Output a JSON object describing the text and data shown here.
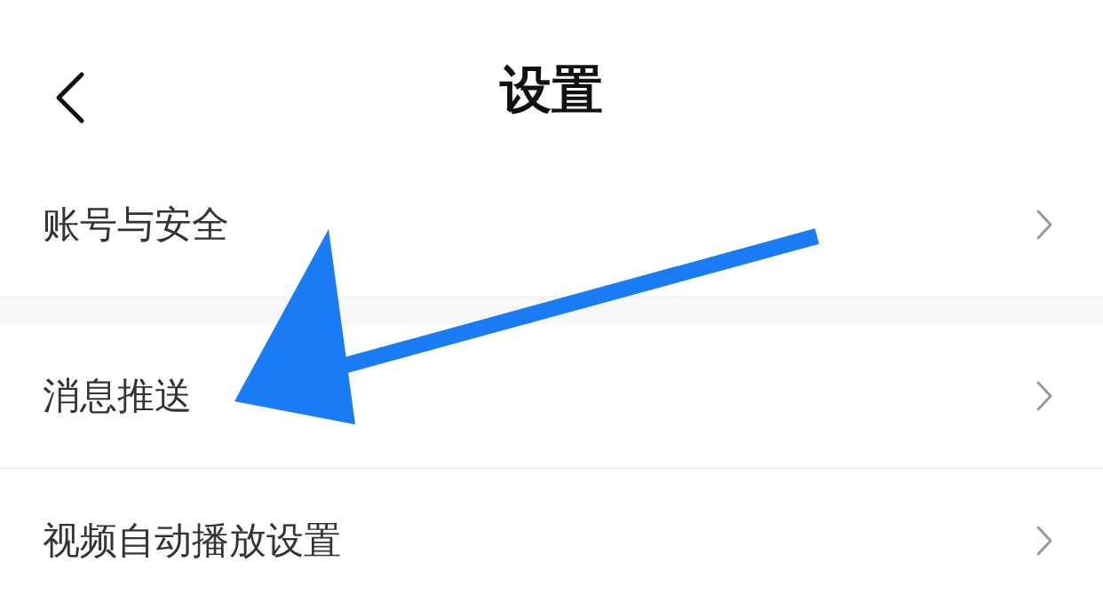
{
  "header": {
    "title": "设置"
  },
  "sections": [
    {
      "items": [
        {
          "label": "账号与安全"
        }
      ]
    },
    {
      "items": [
        {
          "label": "消息推送"
        },
        {
          "label": "视频自动播放设置"
        }
      ]
    }
  ]
}
